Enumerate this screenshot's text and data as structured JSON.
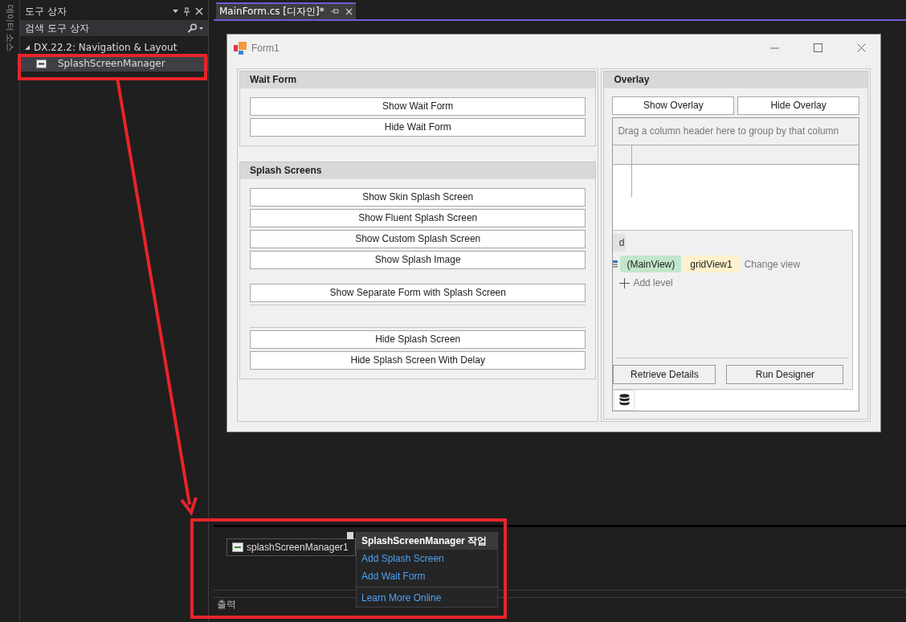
{
  "side_tab": {
    "label": "데이터 소스"
  },
  "toolbox": {
    "title": "도구 상자",
    "search": {
      "placeholder": "검색 도구 상자"
    },
    "groups": [
      {
        "label": "DX.22.2: Navigation & Layout",
        "expanded": true,
        "items": [
          {
            "label": "SplashScreenManager",
            "selected": true
          }
        ]
      }
    ]
  },
  "document_tab": {
    "title": "MainForm.cs [디자인]*",
    "selected": true
  },
  "form": {
    "title": "Form1",
    "groups": [
      {
        "title": "Wait Form",
        "items": [
          {
            "kind": "button",
            "label": "Show Wait Form"
          },
          {
            "kind": "button",
            "label": "Hide Wait Form"
          }
        ]
      },
      {
        "title": "Splash Screens",
        "items": [
          {
            "kind": "button",
            "label": "Show Skin Splash Screen"
          },
          {
            "kind": "button",
            "label": "Show Fluent Splash Screen"
          },
          {
            "kind": "button",
            "label": "Show Custom Splash Screen"
          },
          {
            "kind": "button",
            "label": "Show Splash Image"
          },
          {
            "kind": "gap"
          },
          {
            "kind": "button",
            "label": "Show Separate Form with Splash Screen"
          },
          {
            "kind": "spacer"
          },
          {
            "kind": "button",
            "label": "Hide Splash Screen"
          },
          {
            "kind": "button",
            "label": "Hide Splash Screen With Delay"
          }
        ]
      }
    ],
    "overlay": {
      "title": "Overlay",
      "buttons": [
        "Show Overlay",
        "Hide Overlay"
      ],
      "grid": {
        "group_panel": "Drag a column header here to group by that column",
        "level_tab": "d",
        "main_view": "(MainView)",
        "view_name": "gridView1",
        "change_view": "Change view",
        "add_level": "Add level",
        "designer_buttons": [
          "Retrieve Details",
          "Run Designer"
        ]
      }
    }
  },
  "tray": {
    "component": {
      "label": "splashScreenManager1"
    },
    "smart_tag": {
      "title": "SplashScreenManager 작업",
      "actions": [
        {
          "label": "Add Splash Screen",
          "divider_before": false
        },
        {
          "label": "Add Wait Form",
          "divider_before": false
        },
        {
          "label": "Learn More Online",
          "divider_before": true
        }
      ]
    }
  },
  "output_panel": {
    "title": "출력"
  }
}
